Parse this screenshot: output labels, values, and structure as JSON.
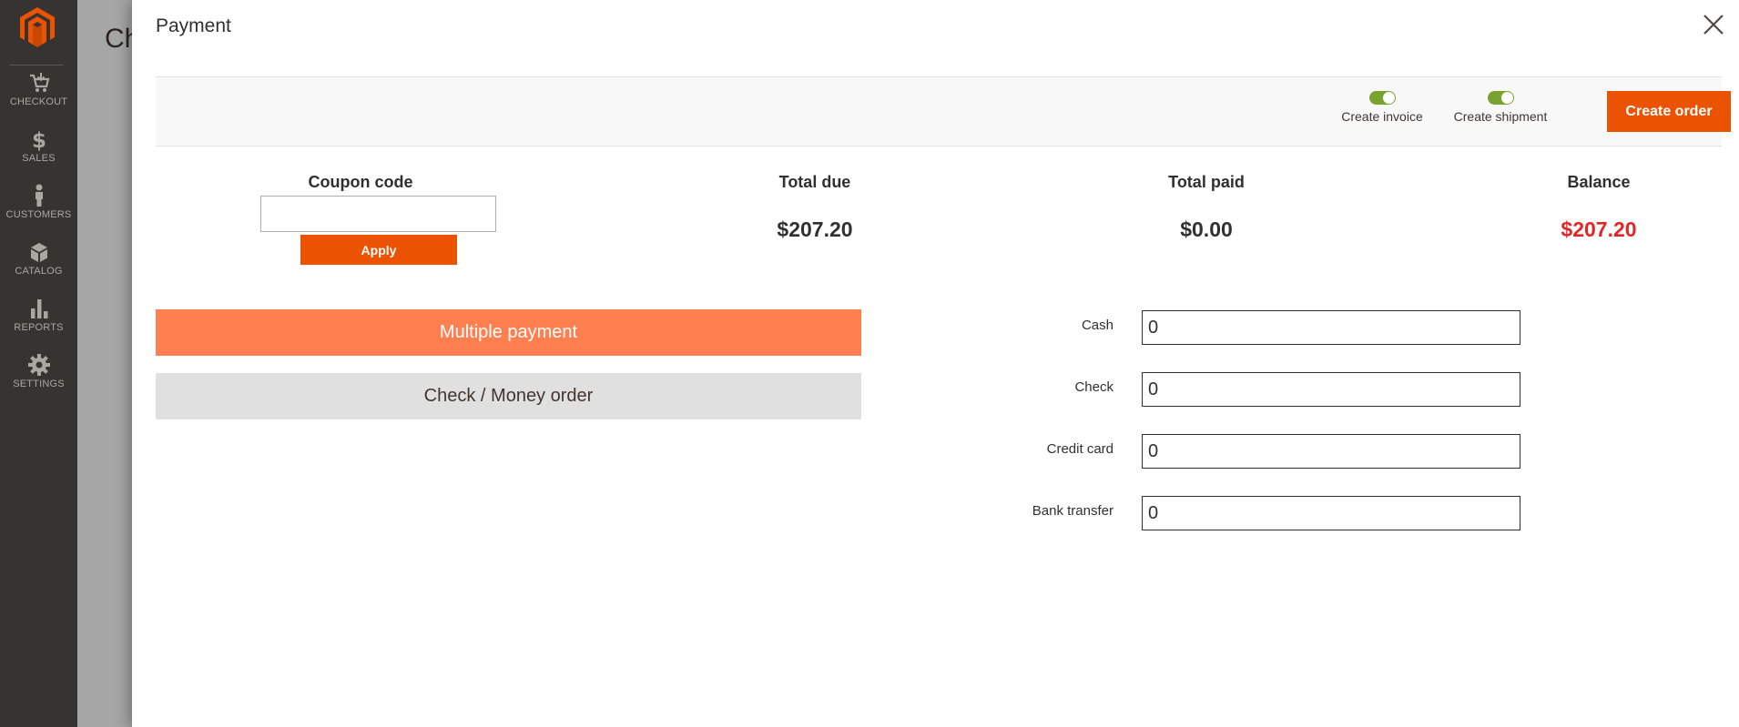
{
  "sidebar": {
    "items": [
      {
        "label": "CHECKOUT",
        "icon": "cart-icon"
      },
      {
        "label": "SALES",
        "icon": "dollar-icon"
      },
      {
        "label": "CUSTOMERS",
        "icon": "person-icon"
      },
      {
        "label": "CATALOG",
        "icon": "box-icon"
      },
      {
        "label": "REPORTS",
        "icon": "bar-chart-icon"
      },
      {
        "label": "SETTINGS",
        "icon": "gear-icon"
      }
    ]
  },
  "background_page": {
    "title_fragment": "Ch"
  },
  "modal": {
    "title": "Payment",
    "toolbar": {
      "create_invoice_label": "Create invoice",
      "create_invoice_on": true,
      "create_shipment_label": "Create shipment",
      "create_shipment_on": true,
      "create_order_label": "Create order"
    },
    "coupon": {
      "label": "Coupon code",
      "value": "",
      "apply_label": "Apply"
    },
    "summary": {
      "total_due_label": "Total due",
      "total_due_value": "$207.20",
      "total_paid_label": "Total paid",
      "total_paid_value": "$0.00",
      "balance_label": "Balance",
      "balance_value": "$207.20"
    },
    "payment_methods": {
      "multiple_label": "Multiple payment",
      "check_money_label": "Check / Money order"
    },
    "payments": [
      {
        "label": "Cash",
        "value": "0"
      },
      {
        "label": "Check",
        "value": "0"
      },
      {
        "label": "Credit card",
        "value": "0"
      },
      {
        "label": "Bank transfer",
        "value": "0"
      }
    ]
  },
  "colors": {
    "accent": "#eb5202",
    "active_method": "#ff7f50",
    "toggle_on": "#79a22e",
    "balance": "#e22626",
    "sidebar_bg": "#373330"
  }
}
